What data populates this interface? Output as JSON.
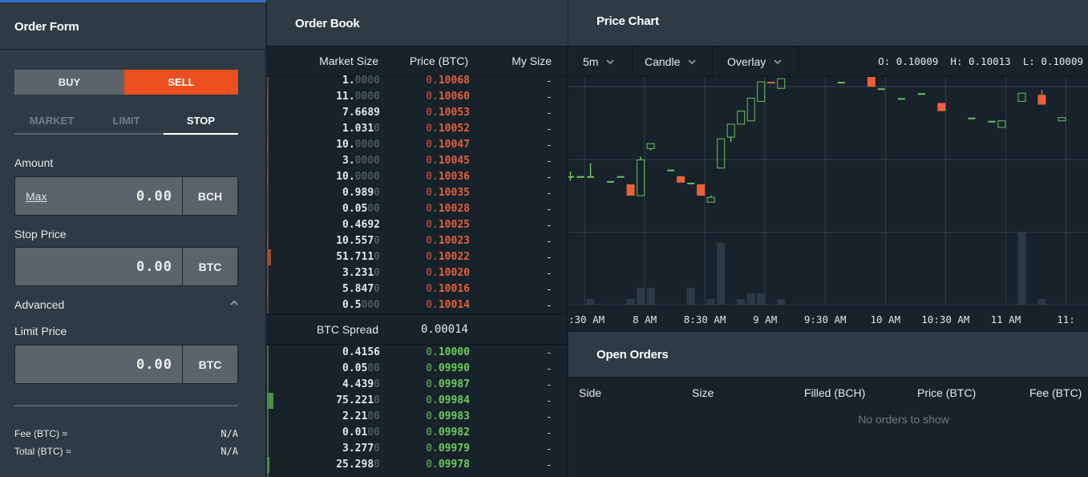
{
  "order_form": {
    "title": "Order Form",
    "sides": {
      "buy": "BUY",
      "sell": "SELL",
      "selected": "SELL"
    },
    "order_types": [
      "MARKET",
      "LIMIT",
      "STOP"
    ],
    "selected_type": "STOP",
    "amount": {
      "label": "Amount",
      "max_link": "Max",
      "value": "0.00",
      "unit": "BCH"
    },
    "stop_price": {
      "label": "Stop Price",
      "value": "0.00",
      "unit": "BTC"
    },
    "advanced": {
      "label": "Advanced",
      "expanded": true
    },
    "limit_price": {
      "label": "Limit Price",
      "value": "0.00",
      "unit": "BTC"
    },
    "fee": {
      "label": "Fee (BTC) ≈",
      "value": "N/A"
    },
    "total": {
      "label": "Total (BTC) ≈",
      "value": "N/A"
    },
    "colors": {
      "sell": "#eb4f1f",
      "buy_inactive": "#5b646c"
    }
  },
  "order_book": {
    "title": "Order Book",
    "columns": {
      "market_size": "Market Size",
      "price": "Price (BTC)",
      "my_size": "My Size"
    },
    "asks": [
      {
        "size": "1.",
        "size_dim": "0000",
        "price_lead": "0.",
        "price": "10068",
        "mine": "-"
      },
      {
        "size": "11.",
        "size_dim": "0000",
        "price_lead": "0.",
        "price": "10060",
        "mine": "-"
      },
      {
        "size": "7.6689",
        "size_dim": "",
        "price_lead": "0.",
        "price": "10053",
        "mine": "-"
      },
      {
        "size": "1.031",
        "size_dim": "0",
        "price_lead": "0.",
        "price": "10052",
        "mine": "-"
      },
      {
        "size": "10.",
        "size_dim": "0000",
        "price_lead": "0.",
        "price": "10047",
        "mine": "-"
      },
      {
        "size": "3.",
        "size_dim": "0000",
        "price_lead": "0.",
        "price": "10045",
        "mine": "-"
      },
      {
        "size": "10.",
        "size_dim": "0000",
        "price_lead": "0.",
        "price": "10036",
        "mine": "-"
      },
      {
        "size": "0.989",
        "size_dim": "0",
        "price_lead": "0.",
        "price": "10035",
        "mine": "-"
      },
      {
        "size": "0.05",
        "size_dim": "00",
        "price_lead": "0.",
        "price": "10028",
        "mine": "-"
      },
      {
        "size": "0.4692",
        "size_dim": "",
        "price_lead": "0.",
        "price": "10025",
        "mine": "-"
      },
      {
        "size": "10.557",
        "size_dim": "0",
        "price_lead": "0.",
        "price": "10023",
        "mine": "-"
      },
      {
        "size": "51.711",
        "size_dim": "0",
        "price_lead": "0.",
        "price": "10022",
        "mine": "-"
      },
      {
        "size": "3.231",
        "size_dim": "0",
        "price_lead": "0.",
        "price": "10020",
        "mine": "-"
      },
      {
        "size": "5.847",
        "size_dim": "0",
        "price_lead": "0.",
        "price": "10016",
        "mine": "-"
      },
      {
        "size": "0.5",
        "size_dim": "000",
        "price_lead": "0.",
        "price": "10014",
        "mine": "-"
      }
    ],
    "spread": {
      "label": "BTC Spread",
      "value": "0.00014"
    },
    "bids": [
      {
        "size": "0.4156",
        "size_dim": "",
        "price_lead": "0.",
        "price": "10000",
        "mine": "-"
      },
      {
        "size": "0.05",
        "size_dim": "00",
        "price_lead": "0.",
        "price": "09990",
        "mine": "-"
      },
      {
        "size": "4.439",
        "size_dim": "0",
        "price_lead": "0.",
        "price": "09987",
        "mine": "-"
      },
      {
        "size": "75.221",
        "size_dim": "0",
        "price_lead": "0.",
        "price": "09984",
        "mine": "-"
      },
      {
        "size": "2.21",
        "size_dim": "00",
        "price_lead": "0.",
        "price": "09983",
        "mine": "-"
      },
      {
        "size": "0.01",
        "size_dim": "00",
        "price_lead": "0.",
        "price": "09982",
        "mine": "-"
      },
      {
        "size": "3.277",
        "size_dim": "0",
        "price_lead": "0.",
        "price": "09979",
        "mine": "-"
      },
      {
        "size": "25.298",
        "size_dim": "0",
        "price_lead": "0.",
        "price": "09978",
        "mine": "-"
      }
    ],
    "colors": {
      "ask": "#e5603a",
      "bid": "#6ed05c"
    }
  },
  "price_chart": {
    "title": "Price Chart",
    "interval": "5m",
    "chart_type": "Candle",
    "overlay": "Overlay",
    "ohlc_readout": "O: 0.10009  H: 0.10013  L: 0.10009"
  },
  "chart_data": {
    "type": "candlestick",
    "title": "Price Chart",
    "interval_minutes": 5,
    "xlabel": "",
    "ylabel": "",
    "x_tick_labels": [
      ":30 AM",
      "8 AM",
      "8:30 AM",
      "9 AM",
      "9:30 AM",
      "10 AM",
      "10:30 AM",
      "11 AM",
      "11:"
    ],
    "x_ticks_minutes": [
      450,
      480,
      510,
      540,
      570,
      600,
      630,
      660,
      690
    ],
    "xlim_minutes": [
      442,
      701
    ],
    "ylim": [
      0.099,
      0.1004
    ],
    "grid": true,
    "colors": {
      "up": "#6ec05f",
      "down": "#eb6238",
      "volume": "#2d3a44",
      "grid": "#333f48"
    },
    "candles": [
      {
        "t": 443,
        "o": 0.09979,
        "h": 0.09982,
        "l": 0.09976,
        "c": 0.09979,
        "vol": 0
      },
      {
        "t": 448,
        "o": 0.09979,
        "h": 0.09979,
        "l": 0.09979,
        "c": 0.09979,
        "vol": 0
      },
      {
        "t": 453,
        "o": 0.09979,
        "h": 0.09987,
        "l": 0.09979,
        "c": 0.09979,
        "vol": 1
      },
      {
        "t": 463,
        "o": 0.09976,
        "h": 0.09976,
        "l": 0.09976,
        "c": 0.09976,
        "vol": 0
      },
      {
        "t": 468,
        "o": 0.09979,
        "h": 0.09979,
        "l": 0.09979,
        "c": 0.09979,
        "vol": 0
      },
      {
        "t": 473,
        "o": 0.09974,
        "h": 0.09974,
        "l": 0.09967,
        "c": 0.09967,
        "vol": 1
      },
      {
        "t": 478,
        "o": 0.09967,
        "h": 0.09991,
        "l": 0.09967,
        "c": 0.09989,
        "vol": 3
      },
      {
        "t": 483,
        "o": 0.09996,
        "h": 0.09998,
        "l": 0.09995,
        "c": 0.09999,
        "vol": 3
      },
      {
        "t": 493,
        "o": 0.09983,
        "h": 0.09983,
        "l": 0.09983,
        "c": 0.09983,
        "vol": 0
      },
      {
        "t": 498,
        "o": 0.09979,
        "h": 0.09979,
        "l": 0.09975,
        "c": 0.09975,
        "vol": 0
      },
      {
        "t": 503,
        "o": 0.09975,
        "h": 0.09975,
        "l": 0.09975,
        "c": 0.09975,
        "vol": 3
      },
      {
        "t": 508,
        "o": 0.09974,
        "h": 0.09974,
        "l": 0.09967,
        "c": 0.09967,
        "vol": 0
      },
      {
        "t": 513,
        "o": 0.09963,
        "h": 0.09967,
        "l": 0.09963,
        "c": 0.09966,
        "vol": 1
      },
      {
        "t": 518,
        "o": 0.09984,
        "h": 0.09984,
        "l": 0.09984,
        "c": 0.10002,
        "vol": 11
      },
      {
        "t": 523,
        "o": 0.10003,
        "h": 0.10011,
        "l": 0.1,
        "c": 0.10011,
        "vol": 0
      },
      {
        "t": 528,
        "o": 0.10011,
        "h": 0.10019,
        "l": 0.10011,
        "c": 0.10019,
        "vol": 1
      },
      {
        "t": 533,
        "o": 0.10013,
        "h": 0.10027,
        "l": 0.10013,
        "c": 0.10027,
        "vol": 2
      },
      {
        "t": 538,
        "o": 0.10025,
        "h": 0.10037,
        "l": 0.10025,
        "c": 0.10037,
        "vol": 2
      },
      {
        "t": 543,
        "o": 0.10037,
        "h": 0.10037,
        "l": 0.10036,
        "c": 0.10036,
        "vol": 0
      },
      {
        "t": 548,
        "o": 0.10033,
        "h": 0.10039,
        "l": 0.10033,
        "c": 0.10039,
        "vol": 1
      },
      {
        "t": 558,
        "o": 0.10044,
        "h": 0.10044,
        "l": 0.10042,
        "c": 0.10042,
        "vol": 0
      },
      {
        "t": 578,
        "o": 0.10037,
        "h": 0.10037,
        "l": 0.10037,
        "c": 0.10037,
        "vol": 0
      },
      {
        "t": 588,
        "o": 0.10043,
        "h": 0.10043,
        "l": 0.10043,
        "c": 0.10043,
        "vol": 0
      },
      {
        "t": 593,
        "o": 0.10043,
        "h": 0.10043,
        "l": 0.10034,
        "c": 0.10034,
        "vol": 0
      },
      {
        "t": 598,
        "o": 0.10033,
        "h": 0.10033,
        "l": 0.10033,
        "c": 0.10033,
        "vol": 0
      },
      {
        "t": 608,
        "o": 0.10027,
        "h": 0.10027,
        "l": 0.10027,
        "c": 0.10027,
        "vol": 0
      },
      {
        "t": 618,
        "o": 0.1003,
        "h": 0.1003,
        "l": 0.1003,
        "c": 0.1003,
        "vol": 0
      },
      {
        "t": 628,
        "o": 0.10024,
        "h": 0.10024,
        "l": 0.10019,
        "c": 0.10019,
        "vol": 0
      },
      {
        "t": 643,
        "o": 0.10015,
        "h": 0.10015,
        "l": 0.10015,
        "c": 0.10015,
        "vol": 0
      },
      {
        "t": 653,
        "o": 0.10013,
        "h": 0.10013,
        "l": 0.10013,
        "c": 0.10013,
        "vol": 0
      },
      {
        "t": 658,
        "o": 0.10009,
        "h": 0.10013,
        "l": 0.10009,
        "c": 0.10013,
        "vol": 0
      },
      {
        "t": 668,
        "o": 0.10025,
        "h": 0.1003,
        "l": 0.10025,
        "c": 0.1003,
        "vol": 13
      },
      {
        "t": 678,
        "o": 0.10029,
        "h": 0.10032,
        "l": 0.10023,
        "c": 0.10023,
        "vol": 1
      },
      {
        "t": 688,
        "o": 0.10013,
        "h": 0.10015,
        "l": 0.10013,
        "c": 0.10015,
        "vol": 0
      }
    ]
  },
  "open_orders": {
    "title": "Open Orders",
    "columns": [
      "Side",
      "Size",
      "Filled (BCH)",
      "Price (BTC)",
      "Fee (BTC)"
    ],
    "empty_message": "No orders to show"
  }
}
